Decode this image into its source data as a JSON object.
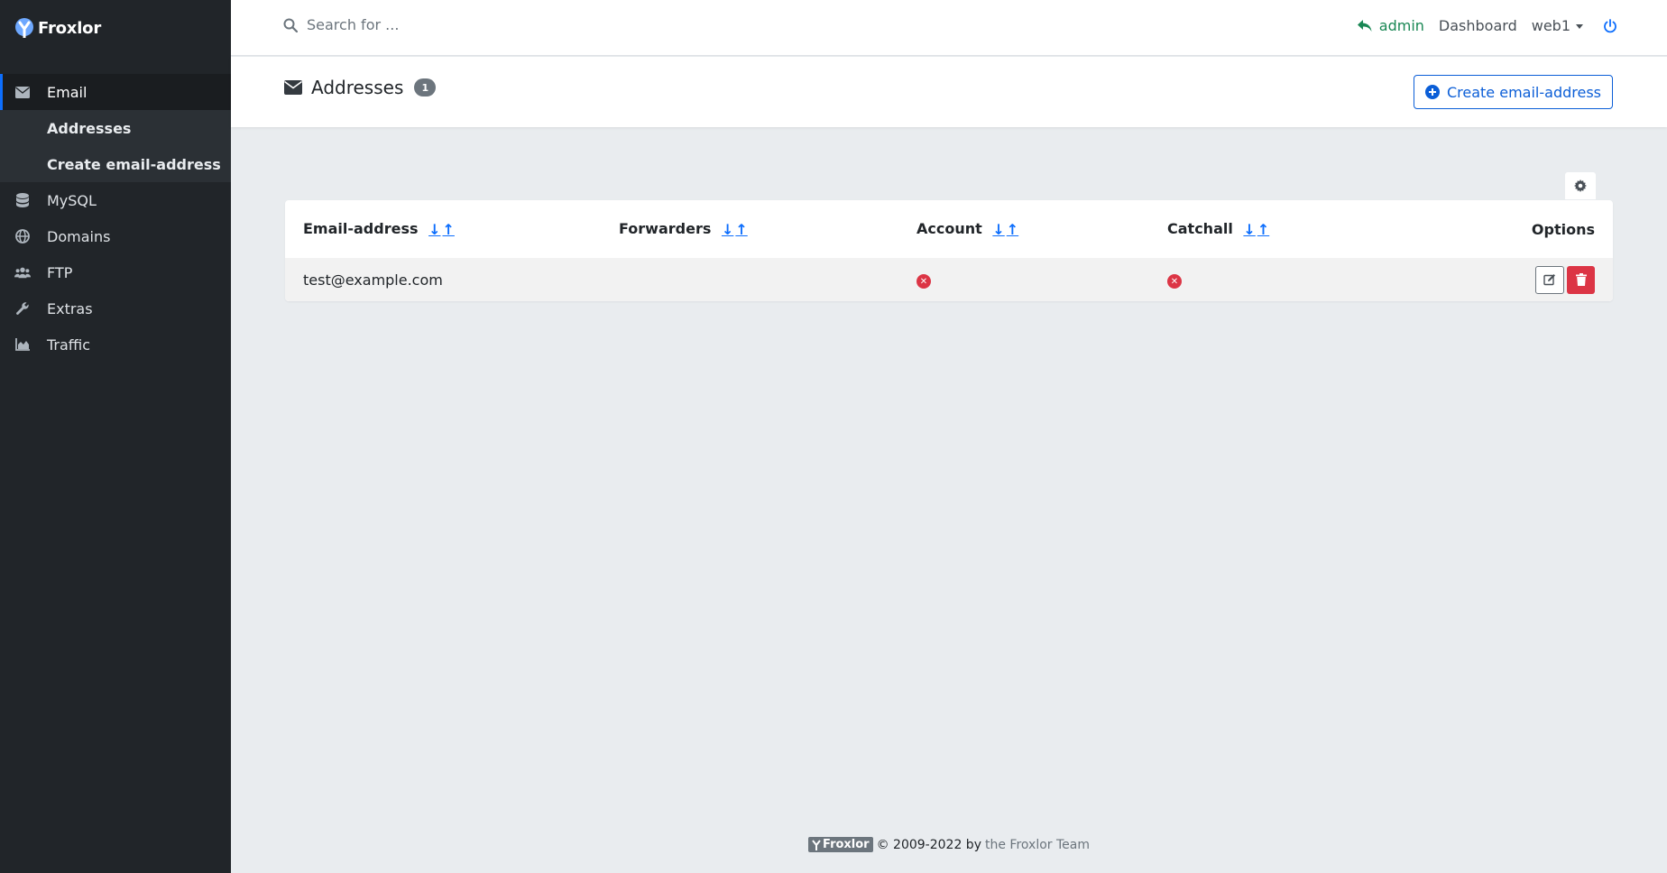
{
  "brand": {
    "name": "Froxlor"
  },
  "sidebar": {
    "items": [
      {
        "label": "Email",
        "icon": "envelope-icon"
      },
      {
        "label": "MySQL",
        "icon": "database-icon"
      },
      {
        "label": "Domains",
        "icon": "globe-icon"
      },
      {
        "label": "FTP",
        "icon": "users-icon"
      },
      {
        "label": "Extras",
        "icon": "wrench-icon"
      },
      {
        "label": "Traffic",
        "icon": "chart-area-icon"
      }
    ],
    "sub_items": [
      {
        "label": "Addresses"
      },
      {
        "label": "Create email-address"
      }
    ]
  },
  "topbar": {
    "search_placeholder": "Search for ...",
    "admin_label": "admin",
    "dashboard_label": "Dashboard",
    "user_label": "web1"
  },
  "page": {
    "title": "Addresses",
    "count": "1",
    "create_button": "Create email-address"
  },
  "table": {
    "columns": [
      {
        "label": "Email-address",
        "sortable": true
      },
      {
        "label": "Forwarders",
        "sortable": true
      },
      {
        "label": "Account",
        "sortable": true
      },
      {
        "label": "Catchall",
        "sortable": true
      },
      {
        "label": "Options",
        "sortable": false
      }
    ],
    "sort_down": "↓",
    "sort_up": "↑",
    "rows": [
      {
        "email": "test@example.com",
        "forwarders": "",
        "account": false,
        "catchall": false
      }
    ]
  },
  "footer": {
    "logo_text": "Froxlor",
    "copyright": "© 2009-2022 by",
    "team": "the Froxlor Team"
  },
  "colors": {
    "sidebar_bg": "#212529",
    "primary": "#0d6efd",
    "success": "#198754",
    "danger": "#dc3545"
  }
}
